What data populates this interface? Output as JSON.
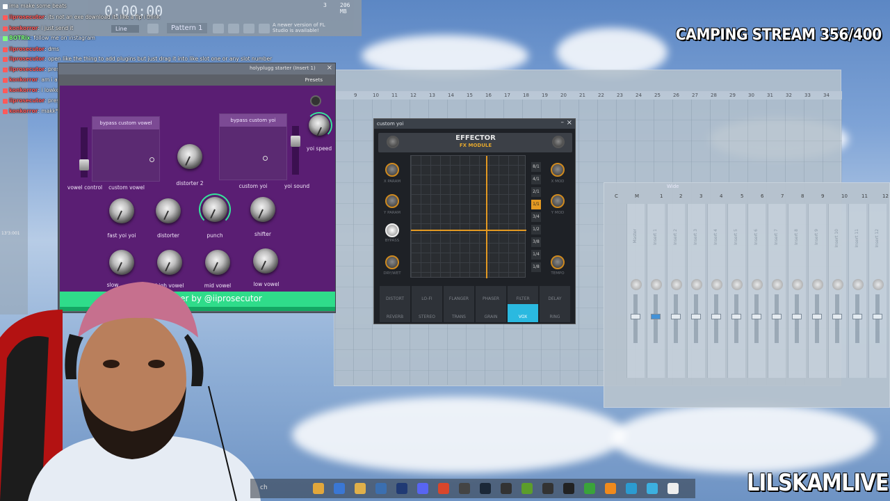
{
  "toolbar": {
    "time": "0:00:00",
    "pattern": "Pattern 1",
    "snap": "Line",
    "cpu_mem": "206 MB",
    "cpu_val": "3",
    "update_notice": "A newer version of FL Studio is available!"
  },
  "chat": [
    {
      "user": "",
      "text": "ima make some beats",
      "color": "#ffffff"
    },
    {
      "user": "iiprosecutor",
      "text": ": its not an exe download its like a flp i think",
      "color": "#ff5a5a"
    },
    {
      "user": "konkorror",
      "text": ": i just send it",
      "color": "#ff5a5a"
    },
    {
      "user": "BOTRix",
      "text": ": follow me on instagram",
      "color": "#7fff7f"
    },
    {
      "user": "iiprosecutor",
      "text": ": dms",
      "color": "#ff5a5a"
    },
    {
      "user": "iiprosecutor",
      "text": ": open like the thing to add plugins but just drag it into like slot one or any slot number",
      "color": "#ff5a5a"
    },
    {
      "user": "iiprosecutor",
      "text": ": press surface",
      "color": "#ff5a5a"
    },
    {
      "user": "konkorror",
      "text": ": am i a clone for trying to make more accurate makk type beats",
      "color": "#ff5a5a"
    },
    {
      "user": "konkorror",
      "text": ": i lowkey never listened to mall before i got into these scene i didn't know he made loud beats too",
      "color": "#ff5a5a"
    },
    {
      "user": "iiprosecutor",
      "text": ": press surface on the top of the grey box",
      "color": "#ff5a5a"
    },
    {
      "user": "konkorror",
      "text": ": makk*",
      "color": "#ff5a5a"
    }
  ],
  "stream": {
    "title": "CAMPING STREAM 356/400",
    "name": "LILSKAMLIVE"
  },
  "timestamp_left": "13'3:001",
  "playlist": {
    "ruler": [
      "9",
      "10",
      "11",
      "12",
      "13",
      "14",
      "15",
      "16",
      "17",
      "18",
      "19",
      "20",
      "21",
      "22",
      "23",
      "24",
      "25",
      "26",
      "27",
      "28",
      "29",
      "30",
      "31",
      "32",
      "33",
      "34"
    ]
  },
  "plugin": {
    "title": "holyplugg starter (Insert 1)",
    "presets": "Presets",
    "pad1_label": "bypass custom vowel",
    "pad2_label": "bypass custom yoi",
    "labels": {
      "vowel_control": "vowel control",
      "custom_vowel": "custom vowel",
      "distorter2": "distorter 2",
      "custom_yoi": "custom yoi",
      "yoi_sound": "yoi sound",
      "yoi_speed": "yoi speed",
      "fast_yoi": "fast yoi yoi",
      "distorter": "distorter",
      "punch": "punch",
      "shifter": "shifter",
      "slow": "slow",
      "high_vowel": "high vowel",
      "mid_vowel": "mid vowel",
      "low_vowel": "low vowel"
    },
    "footer": "starter by @iiprosecutor"
  },
  "effector": {
    "title": "custom yoi",
    "logo1": "EFFECTOR",
    "logo2": "FX MODULE",
    "knob_labels": [
      "X PARAM",
      "Y PARAM",
      "BYPASS",
      "DRY/WET"
    ],
    "right_labels": [
      "X MOD",
      "Y MOD",
      "TEMPO"
    ],
    "rates": [
      "8/1",
      "4/1",
      "2/1",
      "1/1",
      "3/4",
      "1/2",
      "3/8",
      "1/4",
      "1/8"
    ],
    "active_rate": "1/1",
    "modes_row1": [
      "DISTORT",
      "LO-FI",
      "FLANGER",
      "PHASER",
      "FILTER",
      "DELAY"
    ],
    "modes_row2": [
      "REVERB",
      "STEREO",
      "TRANS",
      "GRAIN",
      "VOX",
      "RING"
    ],
    "active_mode": "VOX"
  },
  "mixer": {
    "title": "Wide",
    "headers": [
      "C",
      "M",
      "1",
      "2",
      "3",
      "4",
      "5",
      "6",
      "7",
      "8",
      "9",
      "10",
      "11",
      "12"
    ],
    "strips": [
      "Master",
      "Insert 1",
      "Insert 2",
      "Insert 3",
      "Insert 4",
      "Insert 5",
      "Insert 6",
      "Insert 7",
      "Insert 8",
      "Insert 9",
      "Insert 10",
      "Insert 11",
      "Insert 12"
    ]
  },
  "taskbar": {
    "search": "ch"
  }
}
